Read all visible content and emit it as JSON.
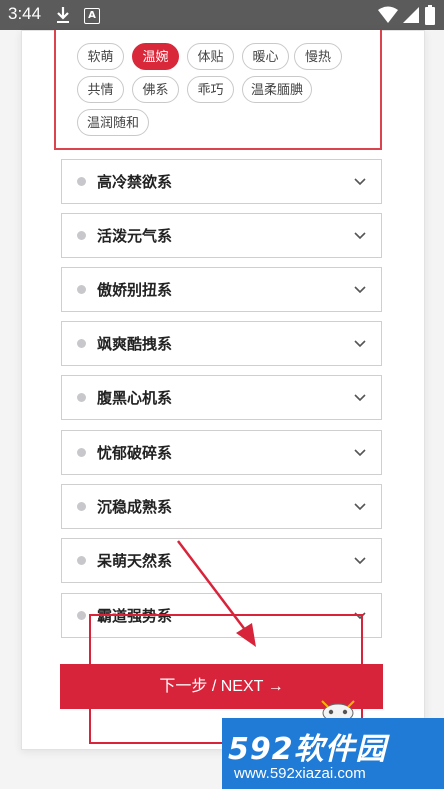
{
  "status_bar": {
    "time": "3:44",
    "a_badge": "A"
  },
  "expanded_group": {
    "tags": [
      {
        "label": "软萌",
        "active": false
      },
      {
        "label": "温婉",
        "active": true
      },
      {
        "label": "体贴",
        "active": false
      },
      {
        "label": "暖心",
        "active": false
      },
      {
        "label": "慢热",
        "active": false
      },
      {
        "label": "共情",
        "active": false
      },
      {
        "label": "佛系",
        "active": false
      },
      {
        "label": "乖巧",
        "active": false
      },
      {
        "label": "温柔腼腆",
        "active": false
      },
      {
        "label": "温润随和",
        "active": false
      }
    ]
  },
  "categories": [
    {
      "label": "高冷禁欲系"
    },
    {
      "label": "活泼元气系"
    },
    {
      "label": "傲娇别扭系"
    },
    {
      "label": "飒爽酷拽系"
    },
    {
      "label": "腹黑心机系"
    },
    {
      "label": "忧郁破碎系"
    },
    {
      "label": "沉稳成熟系"
    },
    {
      "label": "呆萌天然系"
    },
    {
      "label": "霸道强势系"
    }
  ],
  "next_button": {
    "label": "下一步 / NEXT →"
  },
  "watermark": {
    "brand": "592软件园",
    "url": "www.592xiazai.com"
  },
  "colors": {
    "accent": "#d8243b",
    "watermark_bg": "#1f7bd6"
  }
}
